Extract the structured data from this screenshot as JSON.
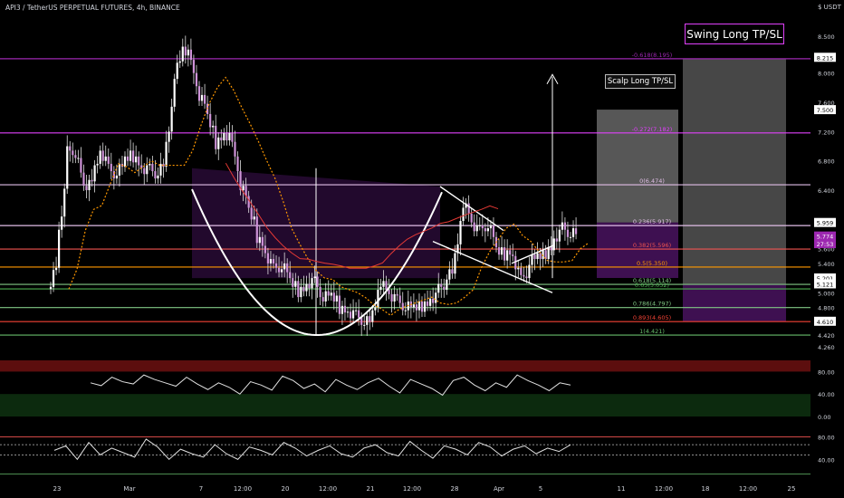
{
  "header": {
    "title": "API3 / TetherUS PERPETUAL FUTURES, 4h, BINANCE"
  },
  "axis_unit": "$ USDT",
  "annotations": {
    "swing_label": "Swing Long TP/SL",
    "scalp_label": "Scalp Long TP/SL"
  },
  "price_badges": [
    {
      "text": "8.215",
      "price": 8.215,
      "bg": "#ffffff",
      "fg": "#000000"
    },
    {
      "text": "7.500",
      "price": 7.5,
      "bg": "#ffffff",
      "fg": "#000000"
    },
    {
      "text": "5.959",
      "price": 5.959,
      "bg": "#ffffff",
      "fg": "#000000"
    },
    {
      "text": "5.774",
      "price": 5.774,
      "bg": "#9c27b0",
      "fg": "#ffffff"
    },
    {
      "text": "27:53",
      "price": 5.67,
      "bg": "#9c27b0",
      "fg": "#ffffff"
    },
    {
      "text": "5.201",
      "price": 5.201,
      "bg": "#ffffff",
      "fg": "#000000"
    },
    {
      "text": "5.121",
      "price": 5.121,
      "bg": "#ffffff",
      "fg": "#000000"
    },
    {
      "text": "4.610",
      "price": 4.61,
      "bg": "#ffffff",
      "fg": "#000000"
    }
  ],
  "chart_data": {
    "type": "candlestick",
    "title": "API3 / TetherUS PERPETUAL FUTURES, 4h, BINANCE",
    "price_range": [
      4.15,
      8.75
    ],
    "y_ticks": [
      "8.500",
      "8.000",
      "7.600",
      "7.200",
      "6.800",
      "6.400",
      "6.000",
      "5.600",
      "5.400",
      "5.000",
      "4.800",
      "4.420",
      "4.260"
    ],
    "x_ticks": [
      "23",
      "Mar",
      "7",
      "12:00",
      "20",
      "12:00",
      "21",
      "12:00",
      "28",
      "Apr",
      "5",
      "11",
      "12:00",
      "18",
      "12:00",
      "25"
    ],
    "fib_levels": [
      {
        "label": "-0.618(8.195)",
        "price": 8.195,
        "color": "#9c27b0"
      },
      {
        "label": "-0.272(7.182)",
        "price": 7.182,
        "color": "#e040fb"
      },
      {
        "label": "0(6.474)",
        "price": 6.474,
        "color": "#e1bee7"
      },
      {
        "label": "0.236(5.917)",
        "price": 5.917,
        "color": "#e1bee7"
      },
      {
        "label": "0.382(5.596)",
        "price": 5.596,
        "color": "#ef5350"
      },
      {
        "label": "0.5(5.350)",
        "price": 5.35,
        "color": "#ff9800"
      },
      {
        "label": "0.618(5.114)",
        "price": 5.114,
        "color": "#81c784"
      },
      {
        "label": "0.65(5.052)",
        "price": 5.052,
        "color": "#4caf50"
      },
      {
        "label": "0.786(4.797)",
        "price": 4.797,
        "color": "#81c784"
      },
      {
        "label": "0.893(4.605)",
        "price": 4.605,
        "color": "#f44336"
      },
      {
        "label": "1(4.421)",
        "price": 4.421,
        "color": "#66bb6a"
      }
    ],
    "price_series": [
      5.05,
      5.6,
      6.9,
      7.0,
      6.4,
      6.5,
      7.0,
      6.7,
      6.6,
      6.8,
      6.9,
      6.7,
      6.7,
      6.6,
      6.8,
      7.9,
      8.4,
      8.2,
      7.7,
      7.5,
      7.0,
      7.2,
      7.1,
      6.5,
      6.2,
      5.8,
      5.6,
      5.3,
      5.4,
      5.2,
      5.0,
      5.1,
      5.2,
      4.9,
      5.0,
      4.8,
      4.75,
      4.7,
      4.6,
      4.6,
      5.2,
      5.0,
      4.9,
      4.8,
      4.8,
      4.8,
      4.9,
      5.0,
      5.2,
      5.3,
      6.3,
      6.0,
      5.8,
      6.0,
      5.6,
      5.5,
      5.6,
      5.1,
      5.4,
      5.5,
      5.5,
      5.7,
      5.9,
      5.8
    ],
    "rsi_levels": [
      "80.00",
      "40.00",
      "0.00"
    ],
    "osc_levels": [
      "80.00",
      "40.00"
    ],
    "rsi_series": [
      60,
      55,
      70,
      62,
      58,
      74,
      66,
      60,
      54,
      70,
      58,
      48,
      60,
      52,
      40,
      62,
      56,
      47,
      72,
      64,
      50,
      58,
      44,
      66,
      56,
      48,
      60,
      68,
      54,
      42,
      66,
      58,
      50,
      38,
      64,
      70,
      56,
      46,
      60,
      52,
      74,
      64,
      56,
      46,
      60,
      56
    ],
    "osc_series": [
      56,
      64,
      40,
      70,
      48,
      60,
      52,
      44,
      76,
      62,
      40,
      58,
      50,
      44,
      66,
      50,
      40,
      62,
      56,
      48,
      70,
      60,
      46,
      56,
      64,
      50,
      44,
      60,
      66,
      52,
      46,
      72,
      56,
      42,
      64,
      58,
      48,
      70,
      62,
      46,
      58,
      64,
      50,
      60,
      54,
      66
    ]
  }
}
